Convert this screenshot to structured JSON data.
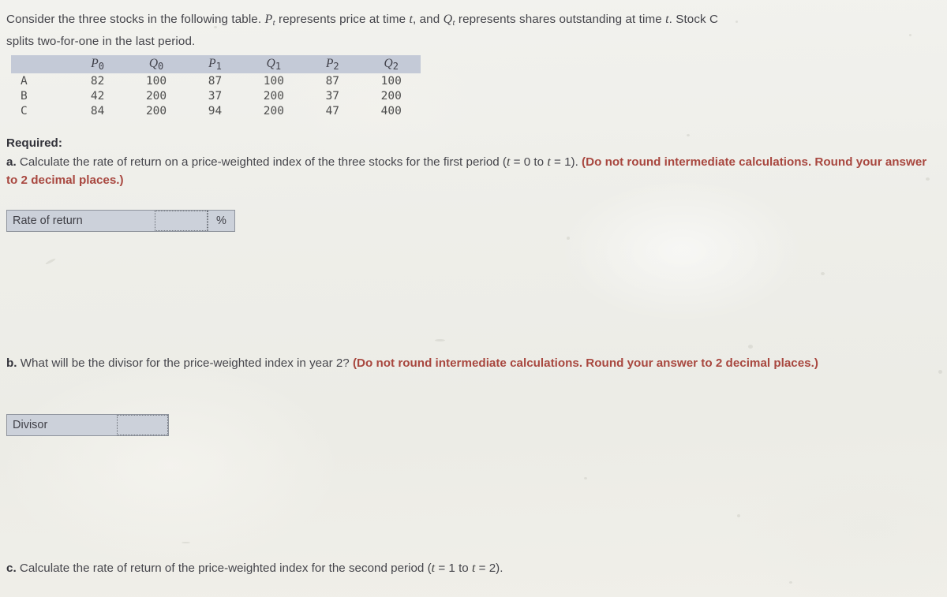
{
  "intro": {
    "line1_a": "Consider the three stocks in the following table. ",
    "p_var": "P",
    "p_sub": "t",
    "line1_b": " represents price at time ",
    "t_var1": "t",
    "line1_c": ", and ",
    "q_var": "Q",
    "q_sub": "t",
    "line1_d": " represents shares outstanding at time ",
    "t_var2": "t",
    "line1_e": ". Stock C",
    "line2": "splits two-for-one in the last period."
  },
  "table": {
    "corner": "",
    "headers": [
      {
        "sym": "P",
        "sub": "0"
      },
      {
        "sym": "Q",
        "sub": "0"
      },
      {
        "sym": "P",
        "sub": "1"
      },
      {
        "sym": "Q",
        "sub": "1"
      },
      {
        "sym": "P",
        "sub": "2"
      },
      {
        "sym": "Q",
        "sub": "2"
      }
    ],
    "rows": [
      {
        "label": "A",
        "values": [
          "82",
          "100",
          "87",
          "100",
          "87",
          "100"
        ]
      },
      {
        "label": "B",
        "values": [
          "42",
          "200",
          "37",
          "200",
          "37",
          "200"
        ]
      },
      {
        "label": "C",
        "values": [
          "84",
          "200",
          "94",
          "200",
          "47",
          "400"
        ]
      }
    ]
  },
  "required": {
    "heading": "Required:",
    "part_a": {
      "label": "a.",
      "text_1": " Calculate the rate of return on a price-weighted index of the three stocks for the first period (",
      "t1": "t",
      "eq1": " = 0 to ",
      "t2": "t",
      "eq2": " = 1). ",
      "red_1": "(Do not round",
      "red_2": "intermediate calculations. Round your answer to 2 decimal places.)"
    },
    "part_b": {
      "label": "b.",
      "text_1": " What will be the divisor for the price-weighted index in year 2? ",
      "red_1": "(Do not round intermediate calculations. Round your answer to 2",
      "red_2": "decimal places.)"
    },
    "part_c": {
      "label": "c.",
      "text_1": " Calculate the rate of return of the price-weighted index for the second period (",
      "t1": "t",
      "eq1": " = 1 to ",
      "t2": "t",
      "eq2": " = 2)."
    }
  },
  "answers": {
    "rate_of_return": {
      "label": "Rate of return",
      "value": "",
      "placeholder": "",
      "unit": "%"
    },
    "divisor": {
      "label": "Divisor",
      "value": "",
      "placeholder": ""
    }
  },
  "colors": {
    "page_background": "#efefea",
    "table_header_band": "#c4cad7",
    "answer_box_fill": "#ccd1da",
    "answer_box_border": "#8e939c",
    "emphasis_red": "#a8473f",
    "body_text": "#46464c"
  }
}
